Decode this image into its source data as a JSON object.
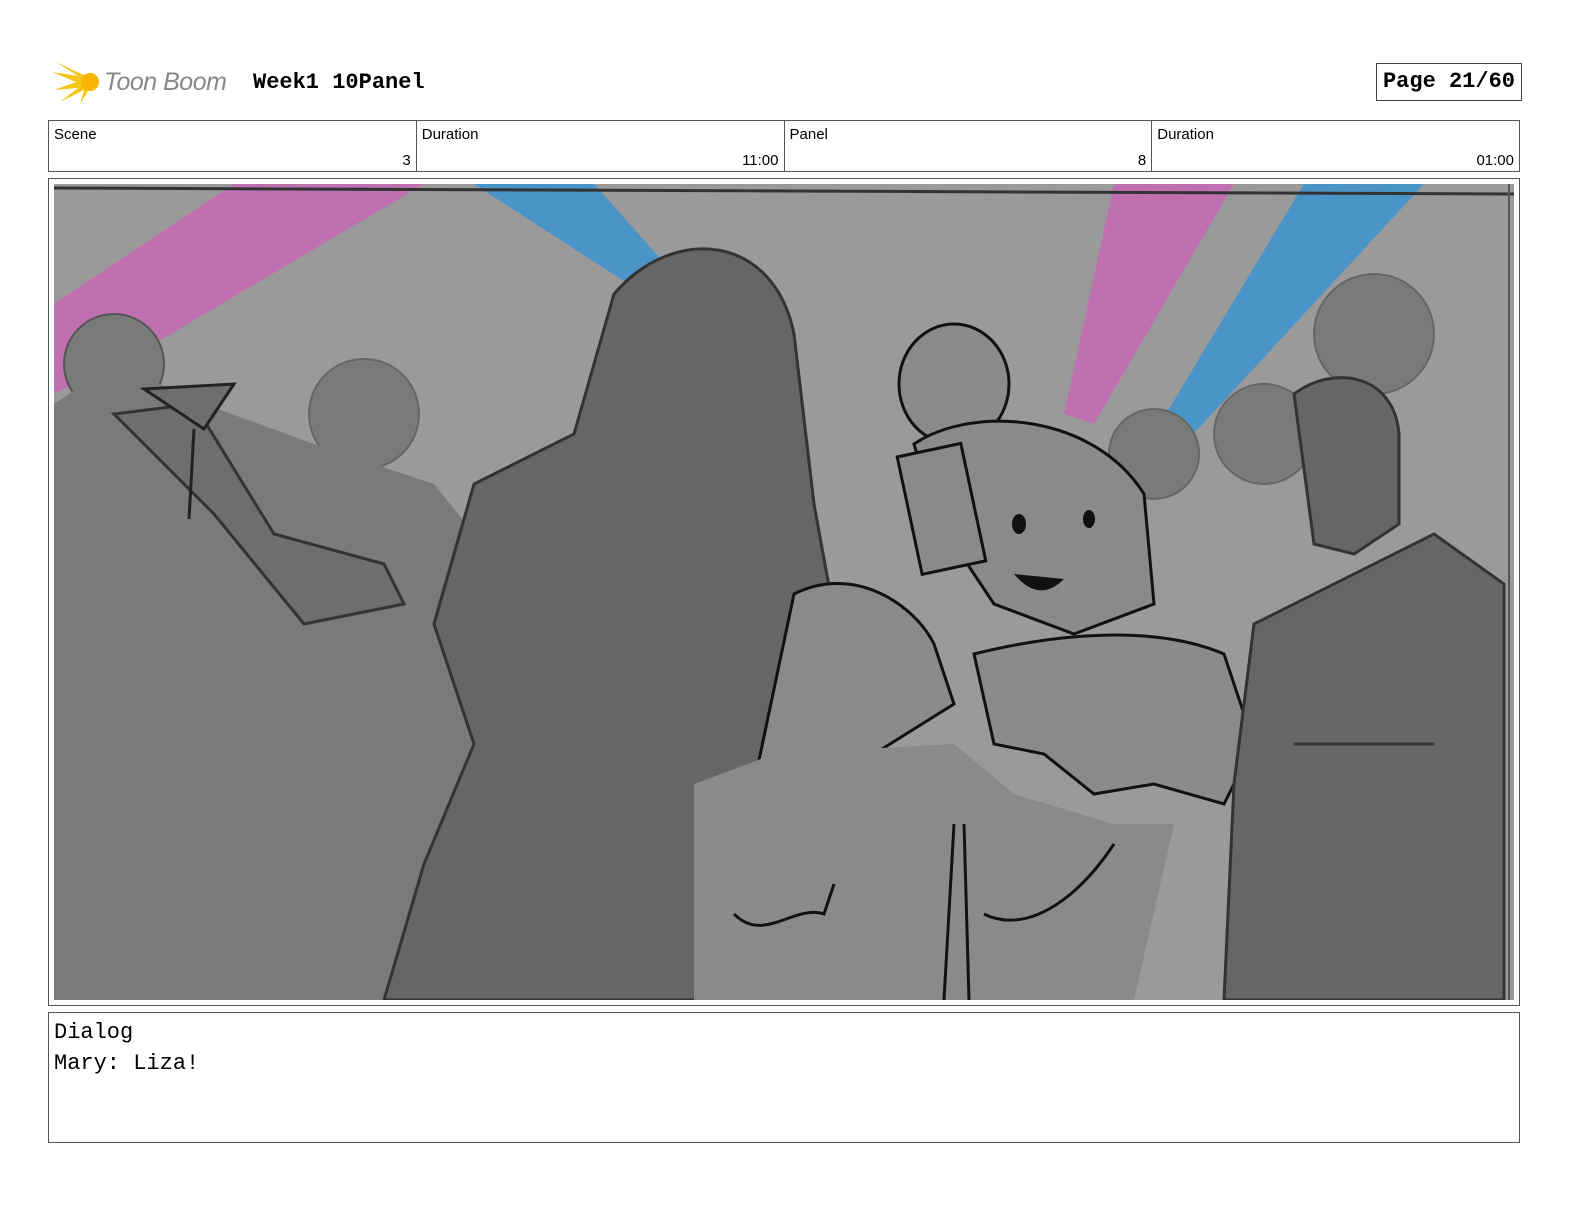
{
  "header": {
    "logo_text": "Toon Boom",
    "project_title": "Week1 10Panel",
    "page_indicator": "Page 21/60"
  },
  "info": {
    "scene_label": "Scene",
    "scene_value": "3",
    "scene_duration_label": "Duration",
    "scene_duration_value": "11:00",
    "panel_label": "Panel",
    "panel_value": "8",
    "panel_duration_label": "Duration",
    "panel_duration_value": "01:00"
  },
  "dialog": {
    "label": "Dialog",
    "text": "Mary: Liza!"
  },
  "colors": {
    "sketch_background": "#9a9a9a",
    "light_beam_pink": "#c070b0",
    "light_beam_blue": "#4a94c8",
    "silhouette_dark": "#666666",
    "silhouette_mid": "#7a7a7a"
  }
}
